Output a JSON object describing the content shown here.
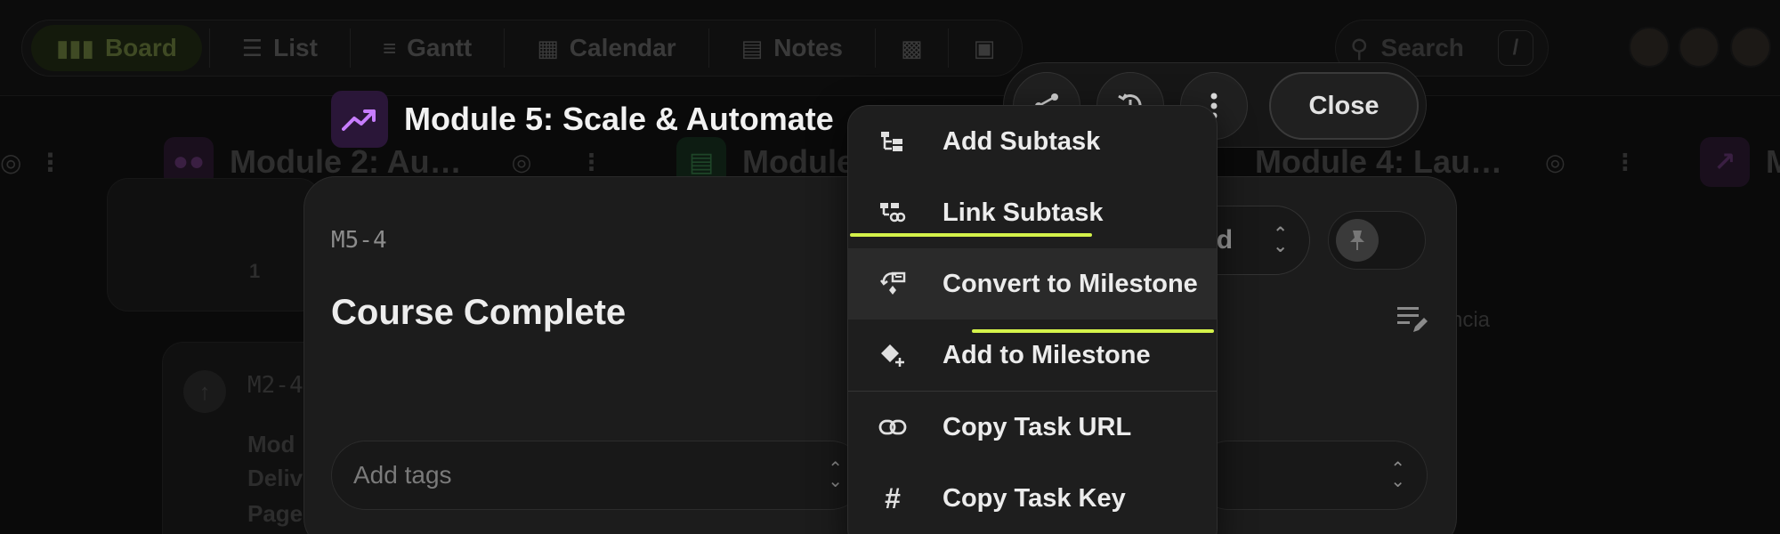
{
  "topbar": {
    "tabs": [
      {
        "label": "Board",
        "icon": "board-icon"
      },
      {
        "label": "List",
        "icon": "list-icon"
      },
      {
        "label": "Gantt",
        "icon": "gantt-icon"
      },
      {
        "label": "Calendar",
        "icon": "calendar-icon"
      },
      {
        "label": "Notes",
        "icon": "notes-icon"
      }
    ],
    "search_placeholder": "Search",
    "search_shortcut": "/"
  },
  "columns": [
    {
      "title": "Module 2: Au…"
    },
    {
      "title": "Module"
    },
    {
      "title": "Module 4: Lau…"
    },
    {
      "title": "M"
    }
  ],
  "background_card": {
    "key": "M2-4",
    "lines": [
      "Mod",
      "Deliv",
      "Page"
    ],
    "count": "1",
    "side_text": "ncia"
  },
  "modal": {
    "module_title": "Module 5: Scale & Automate",
    "task_key": "M5-4",
    "task_title": "Course Complete",
    "tags_placeholder": "Add tags",
    "status_partial": "ted"
  },
  "actions": {
    "close_label": "Close"
  },
  "menu": {
    "items": [
      {
        "label": "Add Subtask",
        "icon": "add-subtask-icon"
      },
      {
        "label": "Link Subtask",
        "icon": "link-subtask-icon"
      },
      {
        "label": "Convert to Milestone",
        "icon": "convert-milestone-icon"
      },
      {
        "label": "Add to Milestone",
        "icon": "add-milestone-icon"
      },
      {
        "label": "Copy Task URL",
        "icon": "link-icon"
      },
      {
        "label": "Copy Task Key",
        "icon": "hash-icon"
      }
    ],
    "hovered_item": "Convert to Milestone"
  },
  "colors": {
    "accent": "#d4f24a",
    "module_icon_bg": "#2a1638",
    "module_icon_fg": "#c77dff",
    "menu_bg": "#1e1e1e",
    "modal_bg": "#1c1c1c"
  }
}
